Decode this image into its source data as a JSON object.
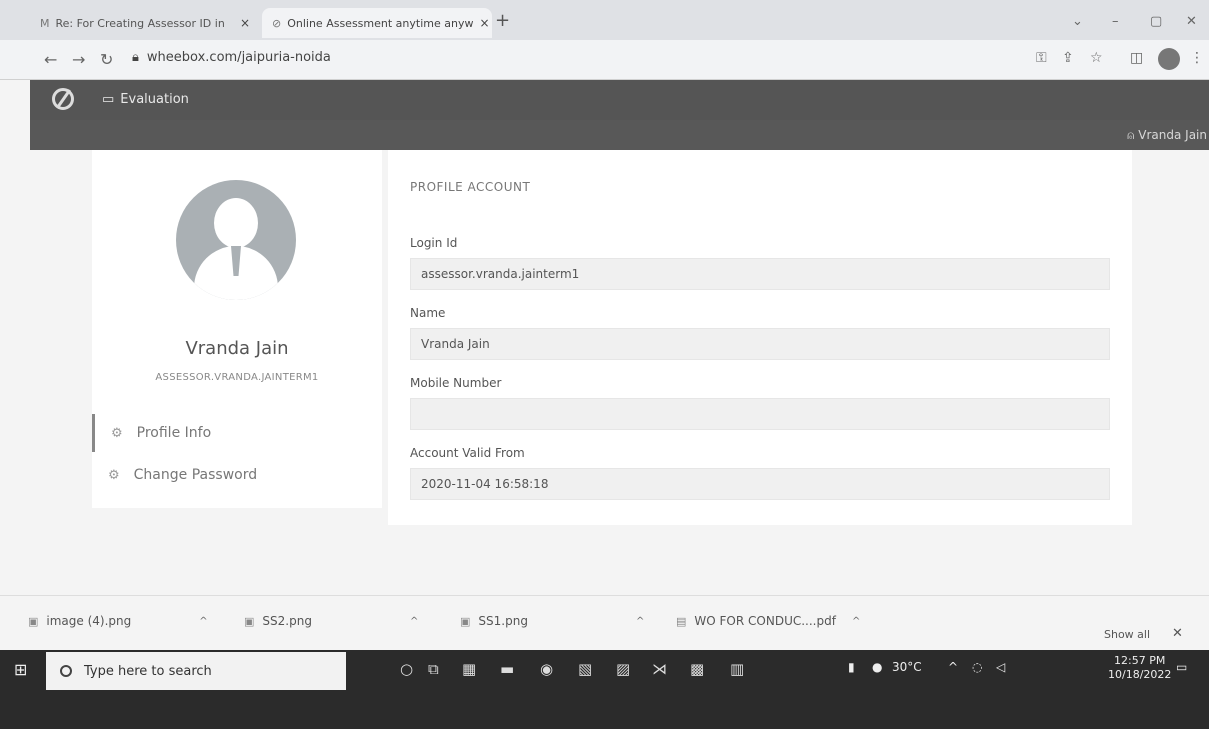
{
  "browser": {
    "tabs": [
      {
        "title": "Re: For Creating Assessor ID in",
        "favicon": "gmail-icon"
      },
      {
        "title": "Online Assessment anytime anyw",
        "favicon": "wheebox-icon"
      }
    ],
    "url": "wheebox.com/jaipuria-noida"
  },
  "app": {
    "nav_label": "Evaluation",
    "user_link": "Vranda Jain"
  },
  "profile": {
    "name": "Vranda Jain",
    "id": "ASSESSOR.VRANDA.JAINTERM1",
    "menu": [
      {
        "label": "Profile Info",
        "active": true
      },
      {
        "label": "Change Password",
        "active": false
      }
    ]
  },
  "account": {
    "section_title": "PROFILE ACCOUNT",
    "fields": [
      {
        "label": "Login Id",
        "value": "assessor.vranda.jainterm1"
      },
      {
        "label": "Name",
        "value": "Vranda Jain"
      },
      {
        "label": "Mobile Number",
        "value": ""
      },
      {
        "label": "Account Valid From",
        "value": "2020-11-04 16:58:18"
      }
    ]
  },
  "downloads": {
    "items": [
      {
        "name": "image (4).png"
      },
      {
        "name": "SS2.png"
      },
      {
        "name": "SS1.png"
      },
      {
        "name": "WO FOR CONDUC....pdf"
      }
    ],
    "show_all": "Show all"
  },
  "taskbar": {
    "search_placeholder": "Type here to search",
    "temperature": "30°C",
    "time": "12:57 PM",
    "date": "10/18/2022"
  }
}
